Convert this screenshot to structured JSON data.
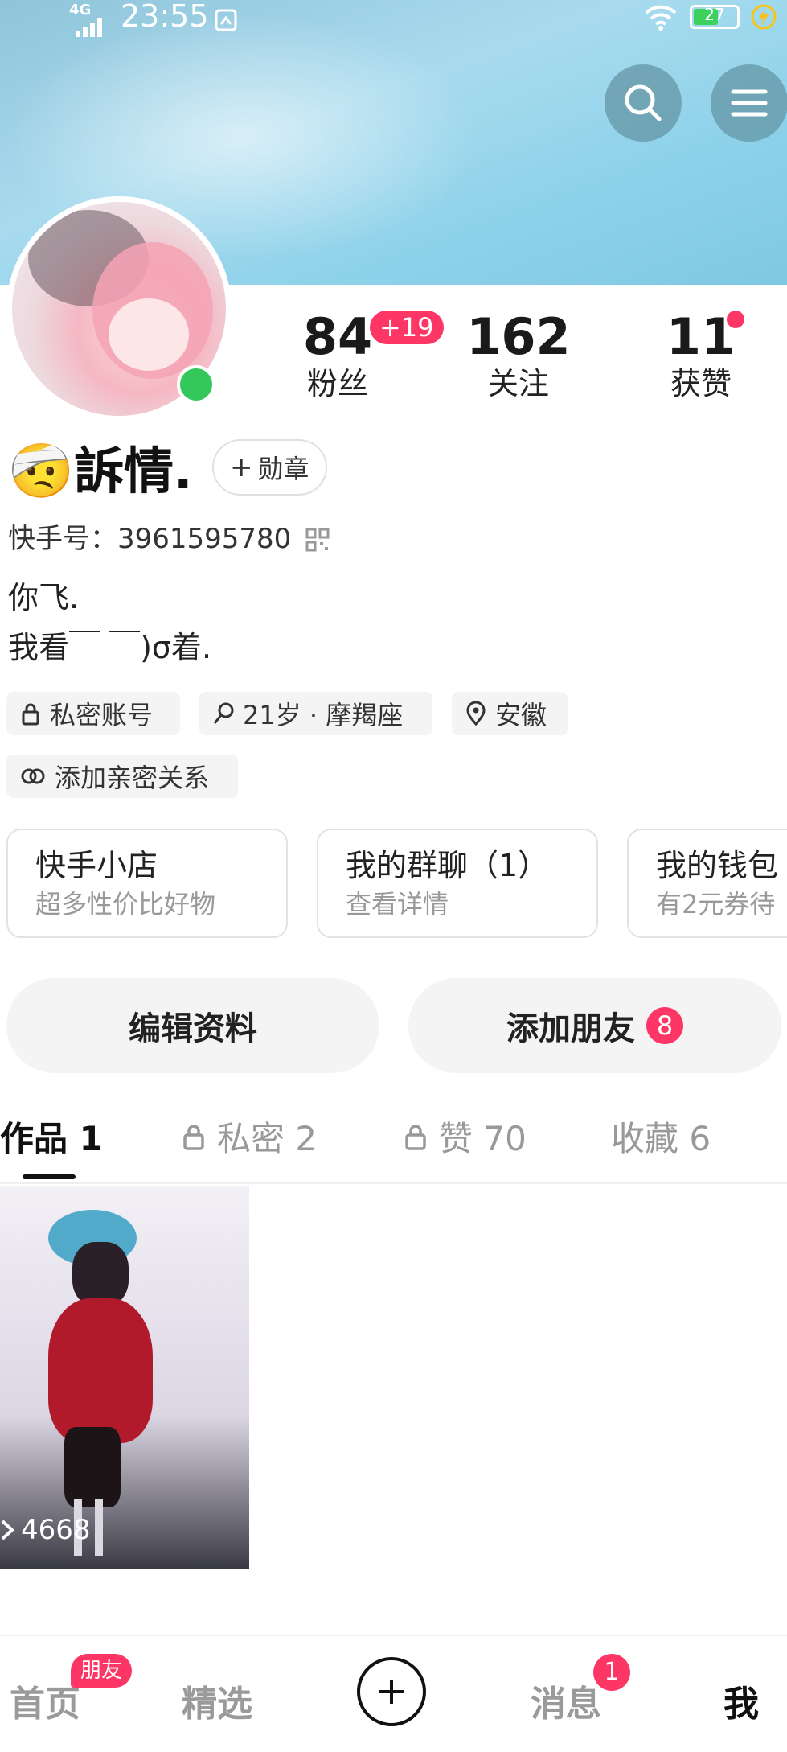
{
  "status_bar": {
    "network": "4G",
    "time": "23:55",
    "battery": "27"
  },
  "header": {
    "search_icon": "search-icon",
    "menu_icon": "menu-icon"
  },
  "stats": [
    {
      "value": "84",
      "label": "粉丝",
      "delta": "+19"
    },
    {
      "value": "162",
      "label": "关注"
    },
    {
      "value": "11",
      "label": "获赞"
    }
  ],
  "profile": {
    "emoji": "🤕",
    "name": "訴情.",
    "medal_label": "勋章",
    "kuaishou_id_label": "快手号：3961595780",
    "bio_line1": "你飞.",
    "bio_line2": "我看￣ ￣)σ着."
  },
  "chips": [
    {
      "label": "私密账号",
      "icon": "lock-icon"
    },
    {
      "label": "21岁 · 摩羯座",
      "icon": "male-icon"
    },
    {
      "label": "安徽",
      "icon": "location-icon"
    },
    {
      "label": "添加亲密关系",
      "icon": "link-hearts-icon"
    }
  ],
  "cards": [
    {
      "title": "快手小店",
      "sub": "超多性价比好物"
    },
    {
      "title": "我的群聊（1）",
      "sub": "查看详情"
    },
    {
      "title": "我的钱包",
      "sub": "有2元券待"
    }
  ],
  "actions": {
    "edit": "编辑资料",
    "add_friend": "添加朋友",
    "add_friend_badge": "8"
  },
  "tabs": [
    {
      "label": "作品 1",
      "locked": false,
      "active": true
    },
    {
      "label": "私密 2",
      "locked": true,
      "active": false
    },
    {
      "label": "赞 70",
      "locked": true,
      "active": false
    },
    {
      "label": "收藏 6",
      "locked": false,
      "active": false
    }
  ],
  "video": {
    "play_count": "4668"
  },
  "bottom_nav": {
    "home": "首页",
    "home_badge": "朋友",
    "featured": "精选",
    "messages": "消息",
    "messages_badge": "1",
    "me": "我"
  }
}
